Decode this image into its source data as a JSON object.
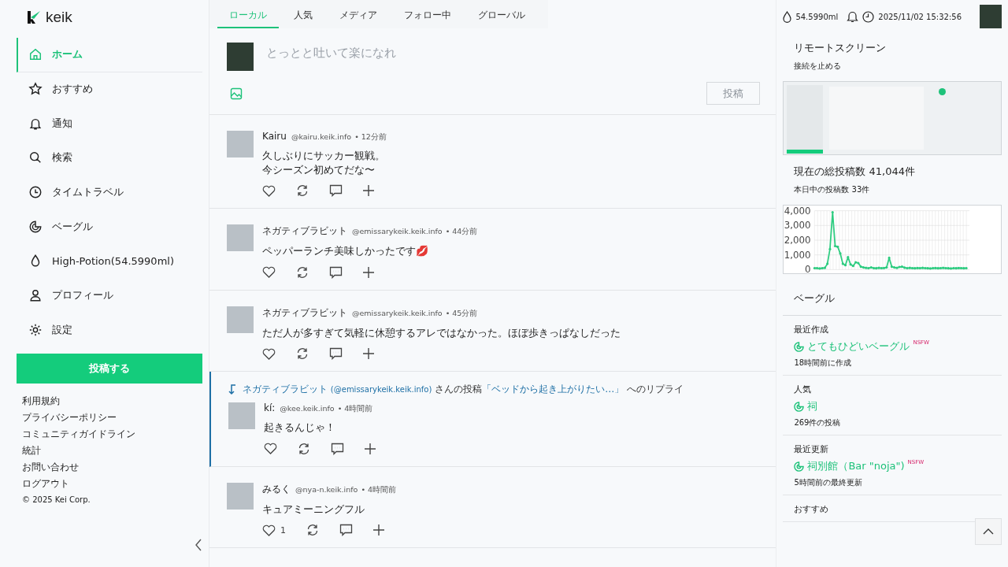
{
  "logo": {
    "text": "keik"
  },
  "nav": {
    "items": [
      {
        "label": "ホーム",
        "selected": true
      },
      {
        "label": "おすすめ",
        "selected": false
      },
      {
        "label": "通知",
        "selected": false
      },
      {
        "label": "検索",
        "selected": false
      },
      {
        "label": "タイムトラベル",
        "selected": false
      },
      {
        "label": "ベーグル",
        "selected": false
      },
      {
        "label": "High-Potion(54.5990ml)",
        "selected": false
      },
      {
        "label": "プロフィール",
        "selected": false
      },
      {
        "label": "設定",
        "selected": false
      }
    ],
    "post_button": "投稿する"
  },
  "footer_links": [
    "利用規約",
    "プライバシーポリシー",
    "コミュニティガイドライン",
    "統計",
    "お問い合わせ",
    "ログアウト"
  ],
  "copyright": "© 2025 Kei Corp.",
  "tabs": [
    {
      "label": "ローカル",
      "selected": true
    },
    {
      "label": "人気",
      "selected": false
    },
    {
      "label": "メディア",
      "selected": false
    },
    {
      "label": "フォロー中",
      "selected": false
    },
    {
      "label": "グローバル",
      "selected": false
    }
  ],
  "composer": {
    "placeholder": "とっとと吐いて楽になれ",
    "submit": {
      "label": "投稿",
      "disabled": true
    }
  },
  "posts": [
    {
      "name": "Kairu",
      "handle": "@kairu.keik.info",
      "time": "• 12分前",
      "lines": [
        "久しぶりにサッカー観戦。",
        "今シーズン初めてだな〜"
      ]
    },
    {
      "name": "ネガティブラビット",
      "handle": "@emissarykeik.keik.info",
      "time": "• 44分前",
      "lines": [
        "ペッパーランチ美味しかったです💋"
      ]
    },
    {
      "name": "ネガティブラビット",
      "handle": "@emissarykeik.keik.info",
      "time": "• 45分前",
      "lines": [
        "ただ人が多すぎて気軽に休憩するアレではなかった。ほぼ歩きっぱなしだった"
      ]
    },
    {
      "reply_to": {
        "name": "ネガティブラビット",
        "handle": "(@emissarykeik.keik.info)",
        "middle": "さんの投稿",
        "quote": "「ベッドから起き上がりたい…」",
        "tail": "へのリプライ"
      },
      "name": "kí:",
      "handle": "@kee.keik.info",
      "time": "• 4時間前",
      "lines": [
        "起きるんじゃ！"
      ]
    },
    {
      "name": "みるく",
      "handle": "@nya-n.keik.info",
      "time": "• 4時間前",
      "lines": [
        "キュアミーニングフル"
      ],
      "likes": "1"
    }
  ],
  "topbar": {
    "potion": "54.5990ml",
    "datetime": "2025/11/02 15:32:56"
  },
  "remote": {
    "title": "リモートスクリーン",
    "action": "接続を止める"
  },
  "stats": {
    "title": "現在の総投稿数 41,044件",
    "today": "本日中の投稿数 33件",
    "chart_data": {
      "type": "line",
      "grid": true,
      "ylim": [
        0,
        4000
      ],
      "yticks": [
        {
          "value": 0,
          "label": "0"
        },
        {
          "value": 1000,
          "label": "1,000"
        },
        {
          "value": 2000,
          "label": "2,000"
        },
        {
          "value": 3000,
          "label": "3,000"
        },
        {
          "value": 4000,
          "label": "4,000"
        }
      ],
      "series": [
        {
          "color": "#2ecc80",
          "values": [
            100,
            100,
            80,
            100,
            120,
            400,
            1400,
            3900,
            1600,
            1550,
            1100,
            400,
            300,
            850,
            350,
            250,
            500,
            450,
            200,
            150,
            120,
            100,
            150,
            100,
            90,
            120,
            100,
            110,
            150,
            800,
            200,
            150,
            120,
            180,
            200,
            130,
            100,
            120,
            100,
            90,
            110,
            100,
            120,
            100,
            90,
            80,
            100,
            110,
            90,
            100,
            120,
            100,
            90,
            80,
            100,
            90,
            110,
            100,
            90,
            100
          ]
        }
      ]
    }
  },
  "bagels": {
    "title": "ベーグル",
    "sections": [
      {
        "heading": "最近作成",
        "name": "とてもひどいベーグル",
        "nsfw_label": "NSFW",
        "meta": "18時間前に作成"
      },
      {
        "heading": "人気",
        "name": "祠",
        "meta": "269件の投稿"
      },
      {
        "heading": "最近更新",
        "name": "祠別館（Bar \"noja\")",
        "nsfw_label": "NSFW",
        "meta": "5時間前の最終更新"
      },
      {
        "heading": "おすすめ"
      }
    ]
  }
}
